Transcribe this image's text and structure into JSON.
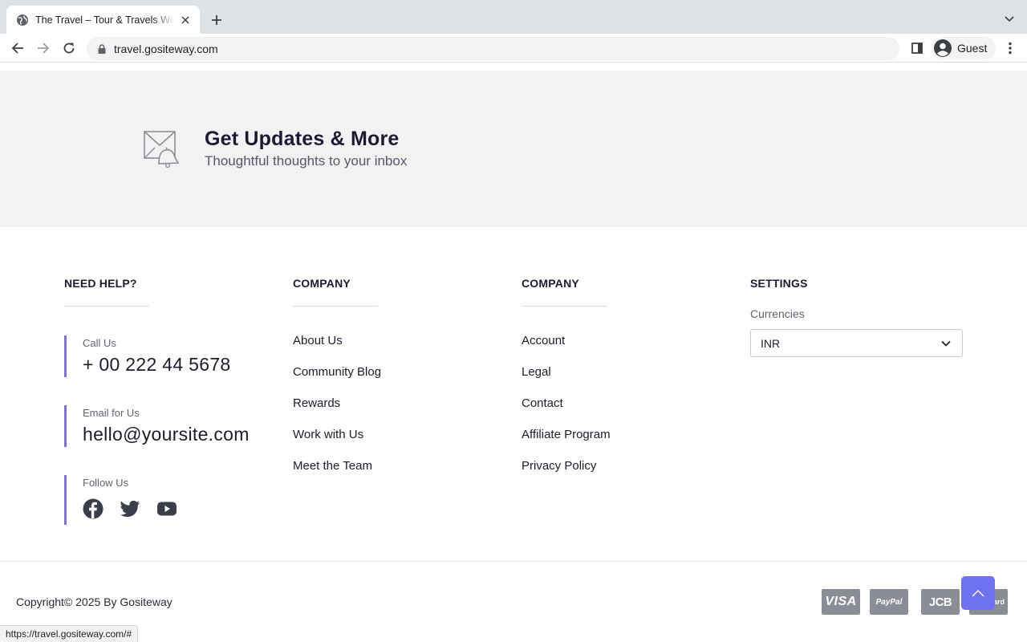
{
  "browser": {
    "tab_title": "The Travel – Tour & Travels Website",
    "url": "travel.gositeway.com",
    "profile_name": "Guest",
    "status_url": "https://travel.gositeway.com/#"
  },
  "newsletter": {
    "title": "Get Updates & More",
    "subtitle": "Thoughtful thoughts to your inbox",
    "icon": "mail-bell-icon"
  },
  "footer": {
    "help": {
      "title": "NEED HELP?",
      "call_label": "Call Us",
      "call_value": "+ 00 222 44 5678",
      "email_label": "Email for Us",
      "email_value": "hello@yoursite.com",
      "follow_label": "Follow Us",
      "socials": [
        "facebook-icon",
        "twitter-icon",
        "youtube-icon"
      ]
    },
    "company1": {
      "title": "COMPANY",
      "links": [
        "About Us",
        "Community Blog",
        "Rewards",
        "Work with Us",
        "Meet the Team"
      ]
    },
    "company2": {
      "title": "COMPANY",
      "links": [
        "Account",
        "Legal",
        "Contact",
        "Affiliate Program",
        "Privacy Policy"
      ]
    },
    "settings": {
      "title": "SETTINGS",
      "currency_label": "Currencies",
      "currency_value": "INR"
    },
    "copyright": "Copyright© 2025 By Gositeway",
    "payments": {
      "visa": "VISA",
      "paypal": "PayPal",
      "jcb": "JCB",
      "mastercard": "card"
    }
  },
  "colors": {
    "accent": "#6e72f0",
    "help_border": "#7b73d8",
    "newsletter_bg": "#f2f2f2"
  }
}
